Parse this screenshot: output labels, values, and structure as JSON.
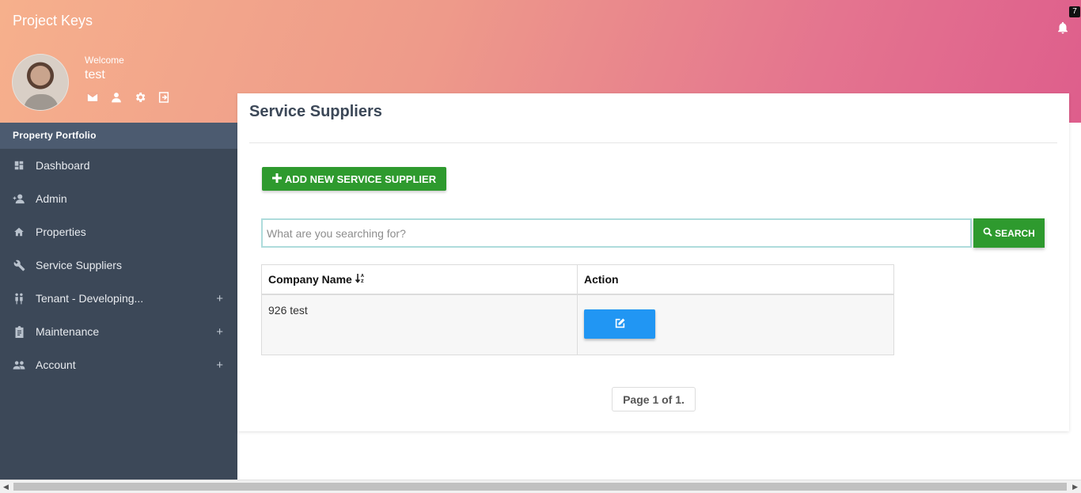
{
  "app": {
    "title": "Project Keys",
    "notification_count": "7"
  },
  "profile": {
    "welcome": "Welcome",
    "username": "test"
  },
  "sidebar": {
    "header": "Property Portfolio",
    "items": [
      {
        "label": "Dashboard",
        "icon": "dashboard-icon",
        "expandable": false
      },
      {
        "label": "Admin",
        "icon": "add-user-icon",
        "expandable": false
      },
      {
        "label": "Properties",
        "icon": "home-icon",
        "expandable": false
      },
      {
        "label": "Service Suppliers",
        "icon": "wrench-icon",
        "expandable": false
      },
      {
        "label": "Tenant - Developing...",
        "icon": "people-icon",
        "expandable": true
      },
      {
        "label": "Maintenance",
        "icon": "clipboard-icon",
        "expandable": true
      },
      {
        "label": "Account",
        "icon": "group-icon",
        "expandable": true
      }
    ],
    "expand_symbol": "+"
  },
  "main": {
    "title": "Service Suppliers",
    "add_button": "ADD NEW SERVICE SUPPLIER",
    "search": {
      "placeholder": "What are you searching for?",
      "value": "",
      "button": "SEARCH"
    },
    "table": {
      "columns": [
        "Company Name",
        "Action"
      ],
      "rows": [
        {
          "company_name": "926 test"
        }
      ]
    },
    "pager": "Page 1 of 1."
  },
  "colors": {
    "sidebar": "#3c4858",
    "accent_green": "#2e9a2e",
    "accent_blue": "#2196f3"
  }
}
